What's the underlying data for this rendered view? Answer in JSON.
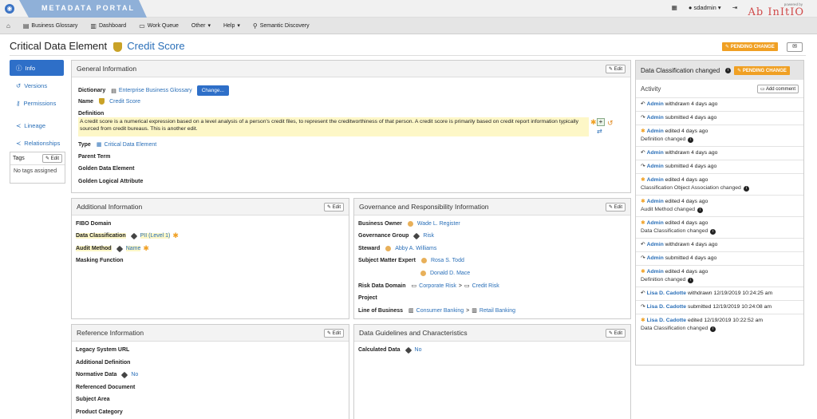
{
  "app": {
    "portal_title": "METADATA PORTAL",
    "user": "sdadmin",
    "brand_small": "powered by",
    "brand_main": "Ab InItIO"
  },
  "nav": [
    {
      "label": "Business Glossary",
      "icon": "book-icon"
    },
    {
      "label": "Dashboard",
      "icon": "dashboard-icon"
    },
    {
      "label": "Work Queue",
      "icon": "inbox-icon"
    },
    {
      "label": "Other",
      "icon": "chevron-down-icon"
    },
    {
      "label": "Help",
      "icon": "chevron-down-icon"
    },
    {
      "label": "Semantic Discovery",
      "icon": "search-icon"
    }
  ],
  "page": {
    "title": "Critical Data Element",
    "subtitle": "Credit Score",
    "pending": "PENDING CHANGE"
  },
  "leftnav": [
    {
      "label": "Info"
    },
    {
      "label": "Versions"
    },
    {
      "label": "Permissions"
    },
    {
      "label": "Lineage"
    },
    {
      "label": "Relationships"
    }
  ],
  "tags": {
    "title": "Tags",
    "edit": "Edit",
    "empty": "No tags assigned"
  },
  "general": {
    "title": "General Information",
    "edit": "Edit",
    "dictionary_label": "Dictionary",
    "dictionary": "Enterprise Business Glossary",
    "change": "Change...",
    "name_label": "Name",
    "name": "Credit Score",
    "definition_label": "Definition",
    "definition": "A credit score is a numerical expression based on a level analysis of a person's credit files, to represent the creditworthiness of that person. A credit score is primarily based on credit report information typically sourced from credit bureaus. This is another edit.",
    "type_label": "Type",
    "type": "Critical Data Element",
    "parent_term": "Parent Term",
    "golden_data": "Golden Data Element",
    "golden_logical": "Golden Logical Attribute"
  },
  "additional": {
    "title": "Additional Information",
    "edit": "Edit",
    "fibo": "FIBO Domain",
    "data_class_label": "Data Classification",
    "data_class": "PII (Level 1)",
    "audit_label": "Audit Method",
    "audit": "Name",
    "masking": "Masking Function"
  },
  "governance": {
    "title": "Governance and Responsibility Information",
    "edit": "Edit",
    "owner_label": "Business Owner",
    "owner": "Wade L. Register",
    "group_label": "Governance Group",
    "group": "Risk",
    "steward_label": "Steward",
    "steward": "Abby A. Williams",
    "sme_label": "Subject Matter Expert",
    "sme1": "Rosa S. Todd",
    "sme2": "Donald D. Mace",
    "risk_label": "Risk Data Domain",
    "risk1": "Corporate Risk",
    "risk_sep": ">",
    "risk2": "Credit Risk",
    "project": "Project",
    "lob_label": "Line of Business",
    "lob1": "Consumer Banking",
    "lob_sep": ">",
    "lob2": "Retail Banking"
  },
  "reference": {
    "title": "Reference Information",
    "edit": "Edit",
    "legacy": "Legacy System URL",
    "add_def": "Additional Definition",
    "normative_label": "Normative Data",
    "normative": "No",
    "ref_doc": "Referenced Document",
    "subject": "Subject Area",
    "category": "Product Category"
  },
  "guidelines": {
    "title": "Data Guidelines and Characteristics",
    "edit": "Edit",
    "calc_label": "Calculated Data",
    "calc": "No"
  },
  "right": {
    "header": "Data Classification changed",
    "pending": "PENDING CHANGE",
    "activity": "Activity",
    "add_comment": "Add comment",
    "items": [
      {
        "icon": "reply-icon",
        "who": "Admin",
        "action": "withdrawn 4 days ago",
        "sub": ""
      },
      {
        "icon": "forward-icon",
        "who": "Admin",
        "action": "submitted 4 days ago",
        "sub": ""
      },
      {
        "icon": "asterisk-icon",
        "who": "Admin",
        "action": "edited 4 days ago",
        "sub": "Definition changed"
      },
      {
        "icon": "reply-icon",
        "who": "Admin",
        "action": "withdrawn 4 days ago",
        "sub": ""
      },
      {
        "icon": "forward-icon",
        "who": "Admin",
        "action": "submitted 4 days ago",
        "sub": ""
      },
      {
        "icon": "asterisk-icon",
        "who": "Admin",
        "action": "edited 4 days ago",
        "sub": "Classification Object Association changed"
      },
      {
        "icon": "asterisk-icon",
        "who": "Admin",
        "action": "edited 4 days ago",
        "sub": "Audit Method changed"
      },
      {
        "icon": "asterisk-icon",
        "who": "Admin",
        "action": "edited 4 days ago",
        "sub": "Data Classification changed"
      },
      {
        "icon": "reply-icon",
        "who": "Admin",
        "action": "withdrawn 4 days ago",
        "sub": ""
      },
      {
        "icon": "forward-icon",
        "who": "Admin",
        "action": "submitted 4 days ago",
        "sub": ""
      },
      {
        "icon": "asterisk-icon",
        "who": "Admin",
        "action": "edited 4 days ago",
        "sub": "Definition changed"
      },
      {
        "icon": "reply-icon",
        "who": "Lisa D. Cadotte",
        "action": "withdrawn 12/19/2019 10:24:25 am",
        "sub": ""
      },
      {
        "icon": "forward-icon",
        "who": "Lisa D. Cadotte",
        "action": "submitted 12/19/2019 10:24:08 am",
        "sub": ""
      },
      {
        "icon": "asterisk-icon",
        "who": "Lisa D. Cadotte",
        "action": "edited 12/19/2019 10:22:52 am",
        "sub": "Data Classification changed"
      }
    ]
  }
}
